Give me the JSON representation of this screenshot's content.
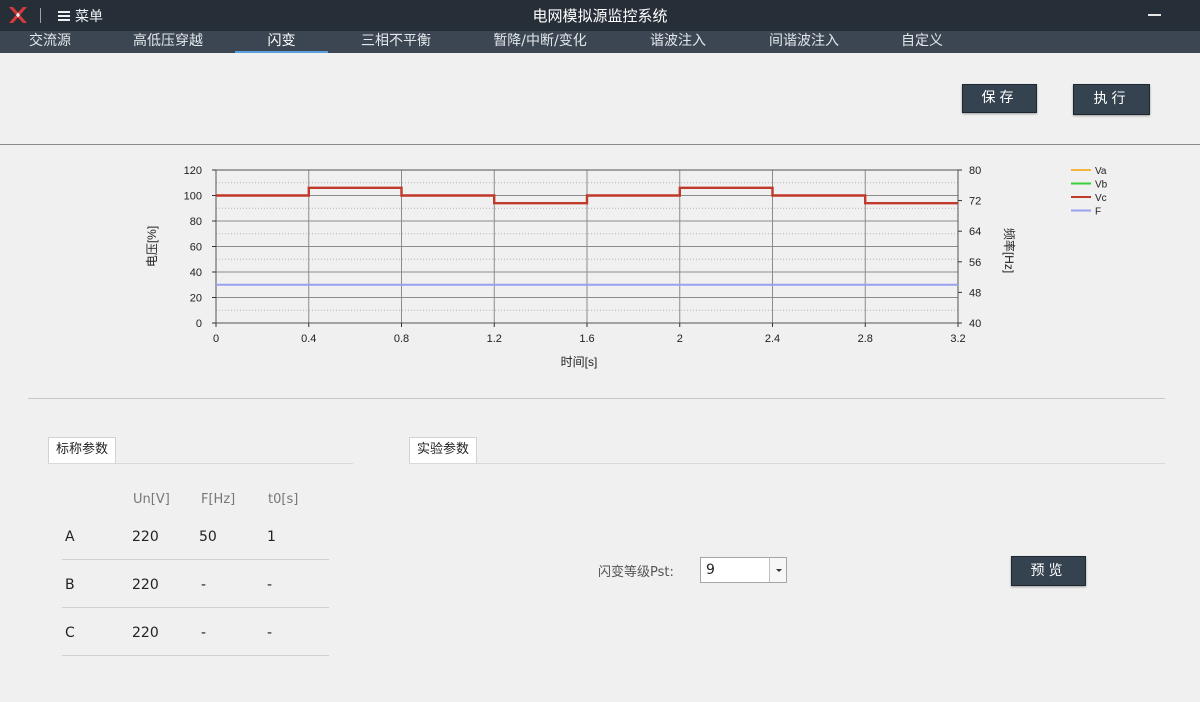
{
  "app": {
    "title": "电网模拟源监控系统",
    "menu_label": "菜单"
  },
  "tabs": [
    {
      "label": "交流源"
    },
    {
      "label": "高低压穿越"
    },
    {
      "label": "闪变",
      "active": true
    },
    {
      "label": "三相不平衡"
    },
    {
      "label": "暂降/中断/变化"
    },
    {
      "label": "谐波注入"
    },
    {
      "label": "间谐波注入"
    },
    {
      "label": "自定义"
    }
  ],
  "toolbar": {
    "save_label": "保存",
    "run_label": "执行"
  },
  "colors": {
    "titlebar": "#262f38",
    "tabbar": "#3b4652",
    "active_tab_underline": "#5aa0dc",
    "button": "#354250",
    "va": "#f5b342",
    "vb": "#3ccf3c",
    "vc": "#c0392b",
    "f": "#9aa0ef"
  },
  "chart_data": {
    "type": "line",
    "xlabel": "时间[s]",
    "ylabel": "电压[%]",
    "y2label": "频率[Hz]",
    "xlim": [
      0,
      3.2
    ],
    "ylim": [
      0,
      120
    ],
    "y2lim": [
      40,
      80
    ],
    "x_ticks": [
      "0",
      "0.4",
      "0.8",
      "1.2",
      "1.6",
      "2",
      "2.4",
      "2.8",
      "3.2"
    ],
    "y_ticks": [
      "0",
      "20",
      "40",
      "60",
      "80",
      "100",
      "120"
    ],
    "y2_ticks": [
      "40",
      "48",
      "56",
      "64",
      "72",
      "80"
    ],
    "grid": true,
    "legend_position": "top-right",
    "series": [
      {
        "name": "Va",
        "axis": "left",
        "color": "#f5b342",
        "points": []
      },
      {
        "name": "Vb",
        "axis": "left",
        "color": "#3ccf3c",
        "points": []
      },
      {
        "name": "Vc",
        "axis": "left",
        "color": "#c0392b",
        "points": [
          [
            0,
            100
          ],
          [
            0.4,
            100
          ],
          [
            0.4,
            106
          ],
          [
            0.8,
            106
          ],
          [
            0.8,
            100
          ],
          [
            1.2,
            100
          ],
          [
            1.2,
            94
          ],
          [
            1.6,
            94
          ],
          [
            1.6,
            100
          ],
          [
            2.0,
            100
          ],
          [
            2.0,
            106
          ],
          [
            2.4,
            106
          ],
          [
            2.4,
            100
          ],
          [
            2.8,
            100
          ],
          [
            2.8,
            94
          ],
          [
            3.2,
            94
          ]
        ]
      },
      {
        "name": "F",
        "axis": "right",
        "color": "#9aa0ef",
        "points": [
          [
            0,
            50
          ],
          [
            3.2,
            50
          ]
        ]
      }
    ]
  },
  "nominal": {
    "title": "标称参数",
    "headers": [
      "Un[V]",
      "F[Hz]",
      "t0[s]"
    ],
    "rows": [
      {
        "phase": "A",
        "un": "220",
        "f": "50",
        "t0": "1"
      },
      {
        "phase": "B",
        "un": "220",
        "f": "-",
        "t0": "-"
      },
      {
        "phase": "C",
        "un": "220",
        "f": "-",
        "t0": "-"
      }
    ]
  },
  "experiment": {
    "title": "实验参数",
    "pst_label": "闪变等级Pst:",
    "pst_value": "9",
    "preview_label": "预览"
  }
}
